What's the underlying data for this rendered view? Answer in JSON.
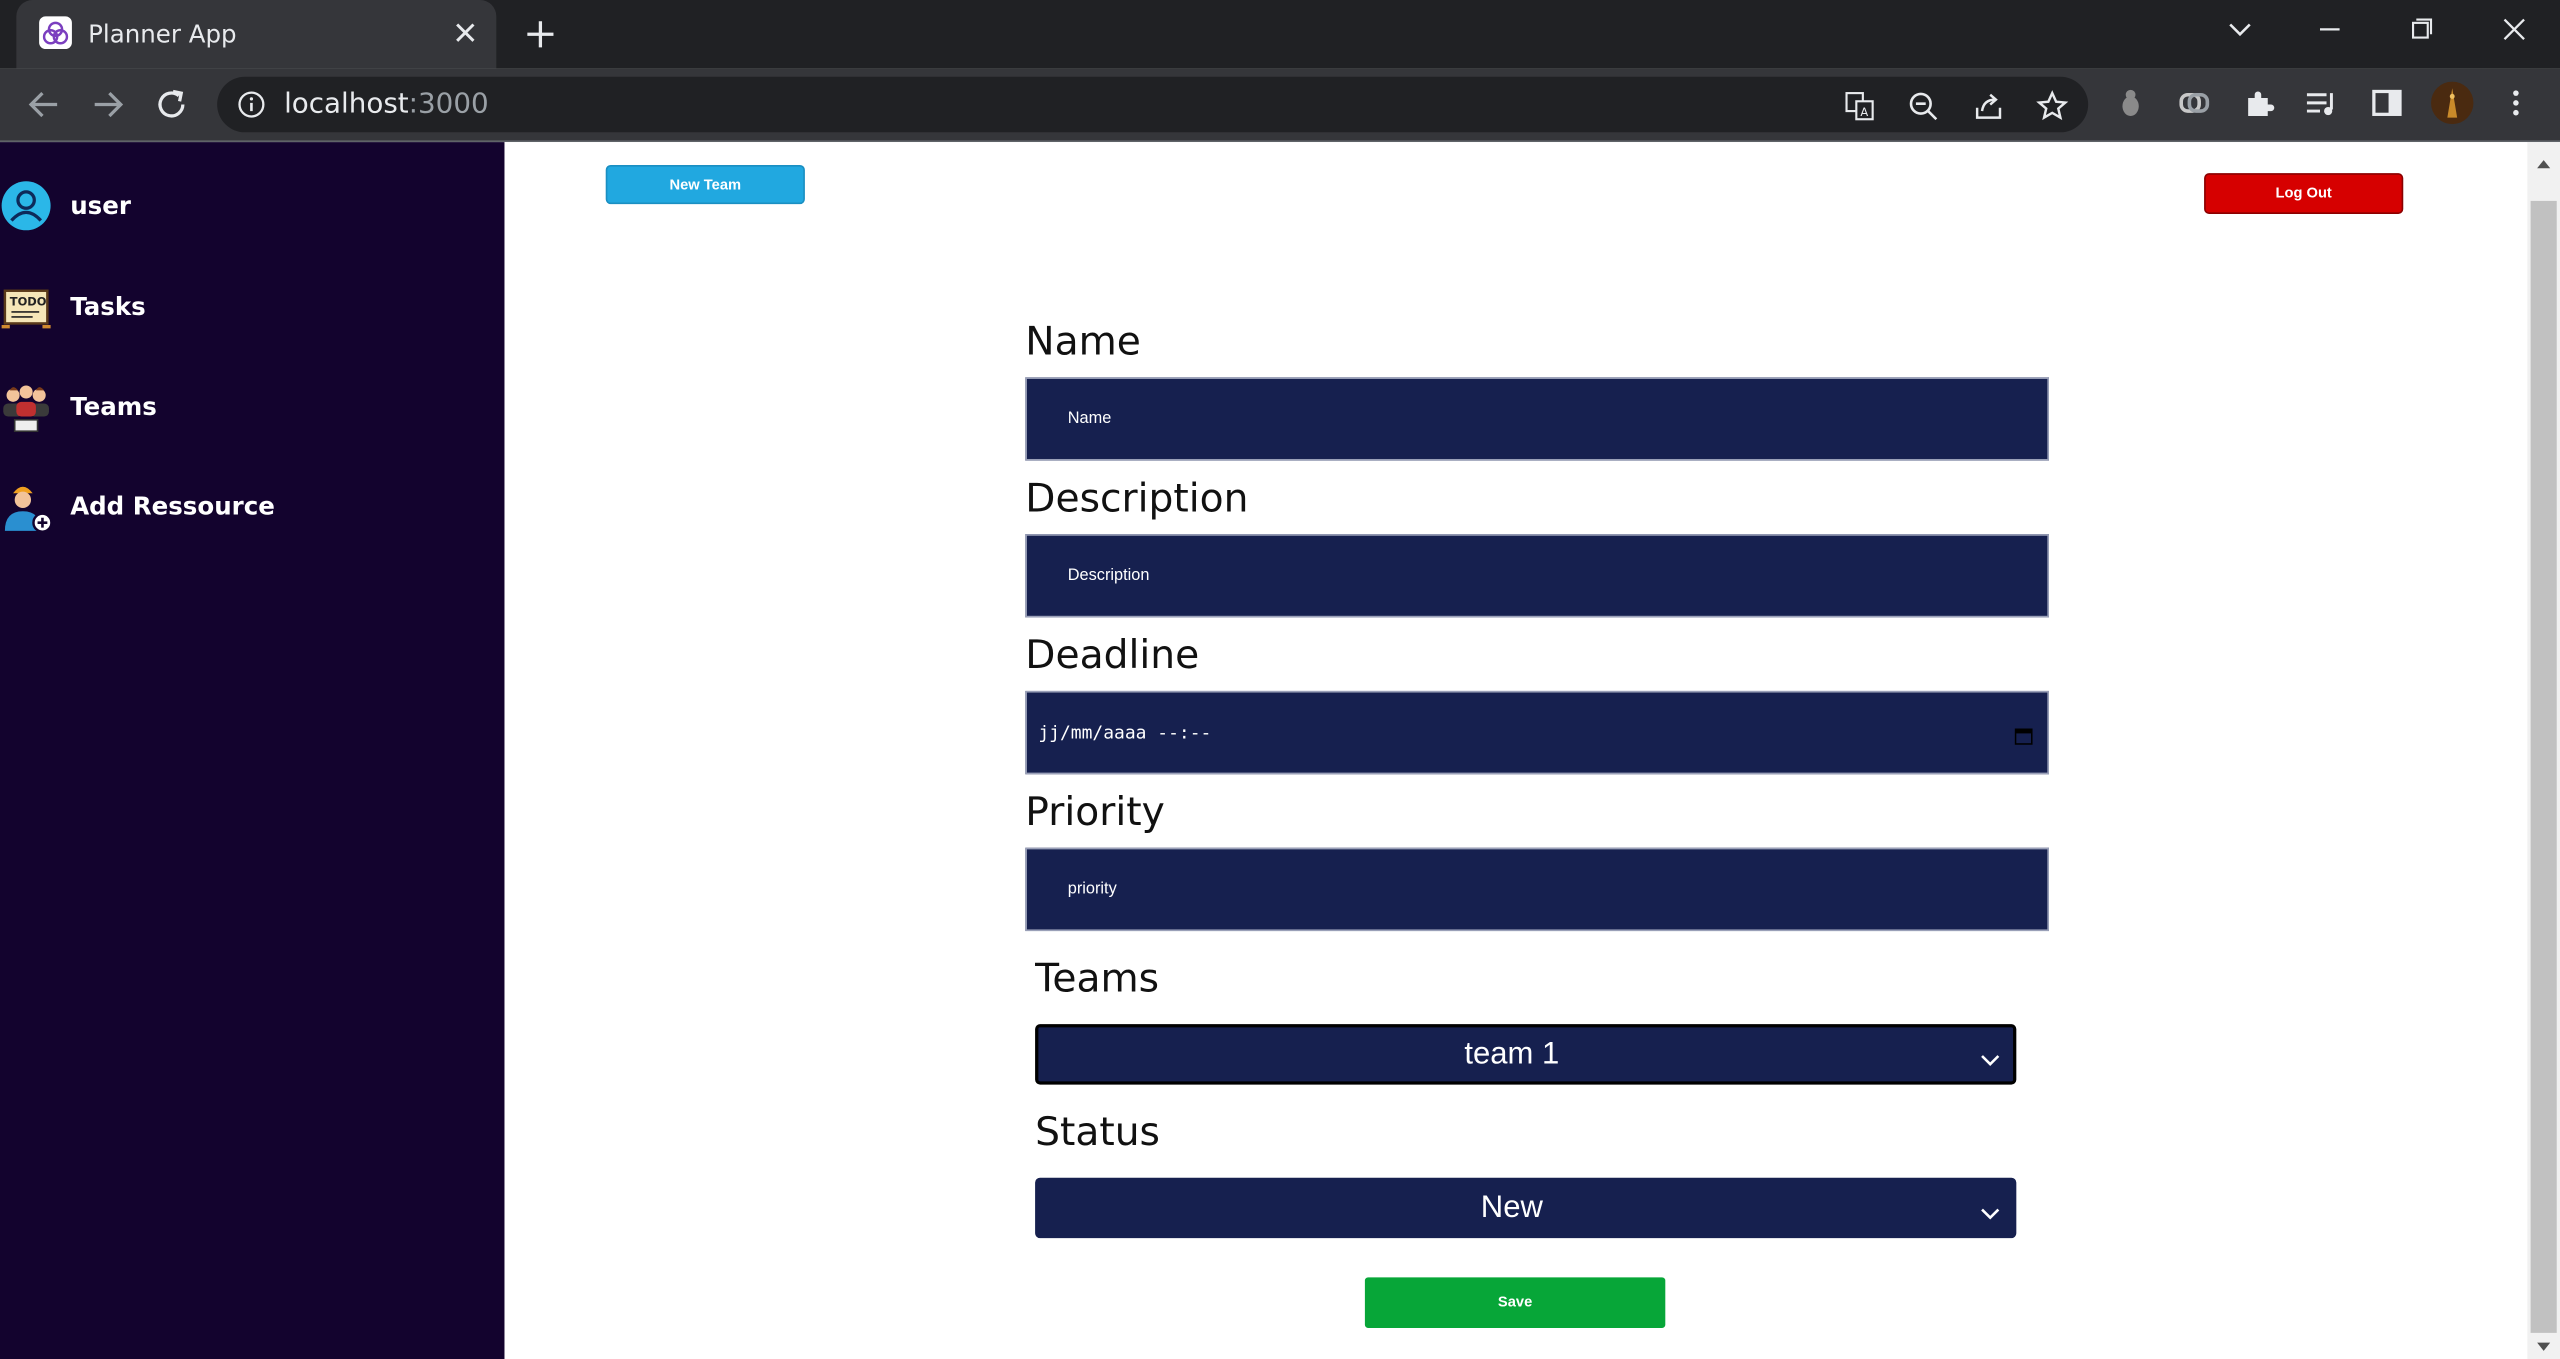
{
  "browser": {
    "tab_title": "Planner App",
    "url_host": "localhost",
    "url_port": ":3000"
  },
  "sidebar": {
    "items": [
      {
        "label": "user",
        "icon": "user-avatar-icon"
      },
      {
        "label": "Tasks",
        "icon": "todo-board-icon"
      },
      {
        "label": "Teams",
        "icon": "team-people-icon"
      },
      {
        "label": "Add Ressource",
        "icon": "add-person-icon"
      }
    ]
  },
  "header": {
    "new_team_label": "New Team",
    "logout_label": "Log Out"
  },
  "form": {
    "name_label": "Name",
    "name_placeholder": "Name",
    "description_label": "Description",
    "description_placeholder": "Description",
    "deadline_label": "Deadline",
    "deadline_placeholder": "jj/mm/aaaa --:--",
    "priority_label": "Priority",
    "priority_placeholder": "priority",
    "teams_label": "Teams",
    "teams_selected": "team 1",
    "status_label": "Status",
    "status_selected": "New",
    "save_label": "Save"
  },
  "colors": {
    "sidebar_bg": "#13032e",
    "input_bg": "#16204f",
    "new_team": "#21a8e0",
    "logout": "#d60000",
    "save": "#07a638"
  }
}
